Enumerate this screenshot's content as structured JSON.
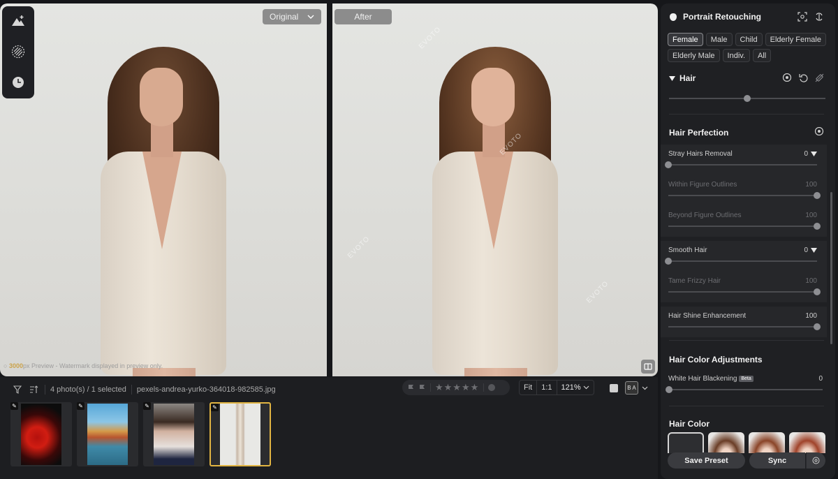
{
  "viewer": {
    "original_label": "Original",
    "after_label": "After",
    "watermark_brand": "3000",
    "watermark_suffix": "px",
    "watermark_text": " Preview - Watermark displayed in preview only.",
    "overlay_mark": "EVOTO",
    "tools": [
      "mountain-plus-icon",
      "stripes-circle-icon",
      "clock-icon"
    ]
  },
  "filmstrip": {
    "count_text": "4 photo(s) / 1 selected",
    "filename": "pexels-andrea-yurko-364018-982585.jpg",
    "zoom_fit": "Fit",
    "zoom_one": "1:1",
    "zoom_level": "121%",
    "ba_label": "B A",
    "thumbs": [
      {
        "kind": "spiral",
        "selected": false
      },
      {
        "kind": "harbor",
        "selected": false
      },
      {
        "kind": "portrait-dark",
        "selected": false
      },
      {
        "kind": "portrait-full",
        "selected": true
      }
    ]
  },
  "panel": {
    "title": "Portrait Retouching",
    "tags": [
      "Female",
      "Male",
      "Child",
      "Elderly Female",
      "Elderly Male",
      "Indiv.",
      "All"
    ],
    "active_tag": "Female",
    "hair_section": "Hair",
    "hair_perfection": "Hair Perfection",
    "rows": [
      {
        "label": "Stray Hairs Removal",
        "value": "0",
        "level": 0.0,
        "dropdown": true,
        "dim": false
      },
      {
        "label": "Within Figure Outlines",
        "value": "100",
        "level": 1.0,
        "dropdown": false,
        "dim": true
      },
      {
        "label": "Beyond Figure Outlines",
        "value": "100",
        "level": 1.0,
        "dropdown": false,
        "dim": true
      },
      {
        "label": "Smooth Hair",
        "value": "0",
        "level": 0.0,
        "dropdown": true,
        "dim": false
      },
      {
        "label": "Tame Frizzy Hair",
        "value": "100",
        "level": 1.0,
        "dropdown": false,
        "dim": true
      },
      {
        "label": "Hair Shine Enhancement",
        "value": "100",
        "level": 1.0,
        "dropdown": false,
        "dim": false
      }
    ],
    "top_slider_level": 0.5,
    "color_adjust_title": "Hair Color Adjustments",
    "white_hair_label": "White Hair Blackening",
    "beta_badge": "Beta",
    "white_hair_value": "0",
    "white_hair_level": 0.0,
    "hair_color_title": "Hair Color",
    "save_preset": "Save Preset",
    "sync": "Sync",
    "colors": {
      "accent": "#e2b542",
      "panel": "#1f2023"
    }
  }
}
